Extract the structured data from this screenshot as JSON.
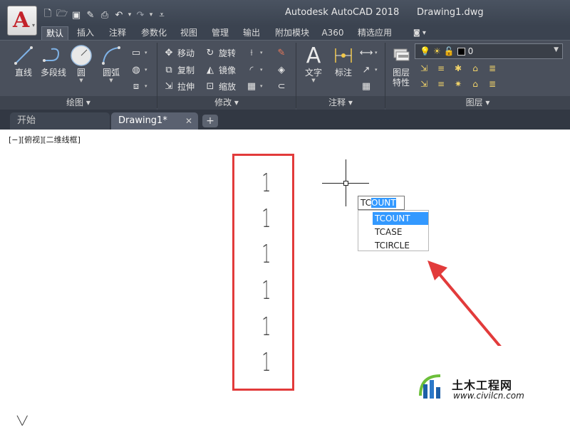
{
  "window": {
    "app_title": "Autodesk AutoCAD 2018",
    "doc_title": "Drawing1.dwg"
  },
  "ribbon_tabs": [
    "默认",
    "插入",
    "注释",
    "参数化",
    "视图",
    "管理",
    "输出",
    "附加模块",
    "A360",
    "精选应用"
  ],
  "ribbon": {
    "draw": {
      "line": "直线",
      "polyline": "多段线",
      "circle": "圆",
      "arc": "圆弧",
      "panel": "绘图 ▾"
    },
    "modify": {
      "move": "移动",
      "rotate": "旋转",
      "copy": "复制",
      "mirror": "镜像",
      "stretch": "拉伸",
      "scale": "缩放",
      "panel": "修改 ▾"
    },
    "annotation": {
      "text": "文字",
      "dimension": "标注",
      "panel": "注释 ▾"
    },
    "layers": {
      "properties_line1": "图层",
      "properties_line2": "特性",
      "current_layer": "0",
      "panel": "图层 ▾"
    }
  },
  "file_tabs": {
    "start": "开始",
    "doc": "Drawing1*",
    "close": "✕",
    "add": "+"
  },
  "viewport_label": "[−][俯视][二维线框]",
  "drawing": {
    "digits": [
      "1",
      "1",
      "1",
      "1",
      "1",
      "1"
    ]
  },
  "command": {
    "typed": "TC",
    "completion": "OUNT"
  },
  "autocomplete": [
    "TCOUNT",
    "TCASE",
    "TCIRCLE"
  ],
  "watermark": {
    "cn": "土木工程网",
    "url": "www.civilcn.com"
  },
  "colors": {
    "accent_red": "#e23b3b",
    "highlight": "#3399ff",
    "ribbon_bg": "#4a505c"
  }
}
